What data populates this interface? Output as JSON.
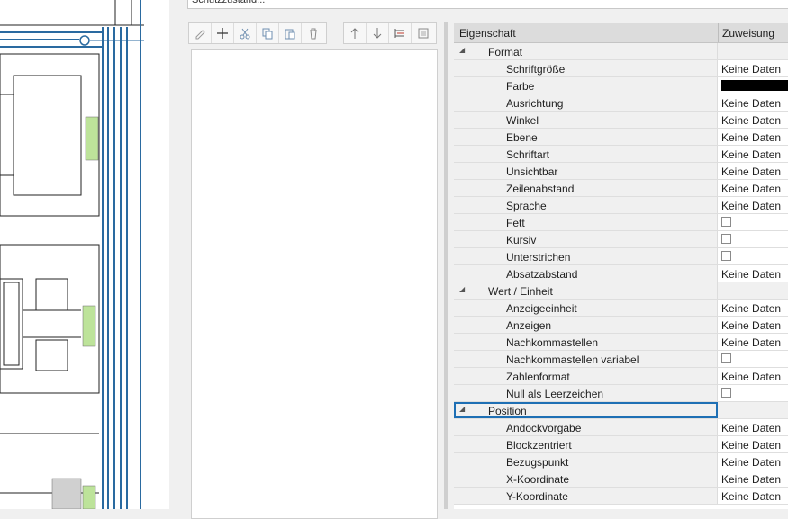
{
  "header_field": {
    "text": "Schutzzustand..."
  },
  "toolbar": {
    "icons": [
      "pencil-icon",
      "plus-icon",
      "scissors-icon",
      "copy-icon",
      "paste-icon",
      "delete-icon",
      "arrow-up-icon",
      "arrow-down-icon",
      "split-icon",
      "window-icon"
    ]
  },
  "grid": {
    "col_property": "Eigenschaft",
    "col_value": "Zuweisung",
    "rows": [
      {
        "type": "cat",
        "name": "Format"
      },
      {
        "type": "prop",
        "name": "Schriftgröße",
        "value": "Keine Daten"
      },
      {
        "type": "color",
        "name": "Farbe",
        "value": "#000000"
      },
      {
        "type": "prop",
        "name": "Ausrichtung",
        "value": "Keine Daten"
      },
      {
        "type": "prop",
        "name": "Winkel",
        "value": "Keine Daten"
      },
      {
        "type": "prop",
        "name": "Ebene",
        "value": "Keine Daten"
      },
      {
        "type": "prop",
        "name": "Schriftart",
        "value": "Keine Daten"
      },
      {
        "type": "prop",
        "name": "Unsichtbar",
        "value": "Keine Daten"
      },
      {
        "type": "prop",
        "name": "Zeilenabstand",
        "value": "Keine Daten"
      },
      {
        "type": "prop",
        "name": "Sprache",
        "value": "Keine Daten"
      },
      {
        "type": "check",
        "name": "Fett"
      },
      {
        "type": "check",
        "name": "Kursiv"
      },
      {
        "type": "check",
        "name": "Unterstrichen"
      },
      {
        "type": "prop",
        "name": "Absatzabstand",
        "value": "Keine Daten"
      },
      {
        "type": "cat",
        "name": "Wert / Einheit"
      },
      {
        "type": "prop",
        "name": "Anzeigeeinheit",
        "value": "Keine Daten"
      },
      {
        "type": "prop",
        "name": "Anzeigen",
        "value": "Keine Daten"
      },
      {
        "type": "prop",
        "name": "Nachkommastellen",
        "value": "Keine Daten"
      },
      {
        "type": "check",
        "name": "Nachkommastellen variabel"
      },
      {
        "type": "prop",
        "name": "Zahlenformat",
        "value": "Keine Daten"
      },
      {
        "type": "check",
        "name": "Null als Leerzeichen"
      },
      {
        "type": "cat",
        "name": "Position",
        "selected": true
      },
      {
        "type": "prop",
        "name": "Andockvorgabe",
        "value": "Keine Daten"
      },
      {
        "type": "prop",
        "name": "Blockzentriert",
        "value": "Keine Daten"
      },
      {
        "type": "prop",
        "name": "Bezugspunkt",
        "value": "Keine Daten"
      },
      {
        "type": "prop",
        "name": "X-Koordinate",
        "value": "Keine Daten"
      },
      {
        "type": "prop",
        "name": "Y-Koordinate",
        "value": "Keine Daten"
      }
    ]
  }
}
